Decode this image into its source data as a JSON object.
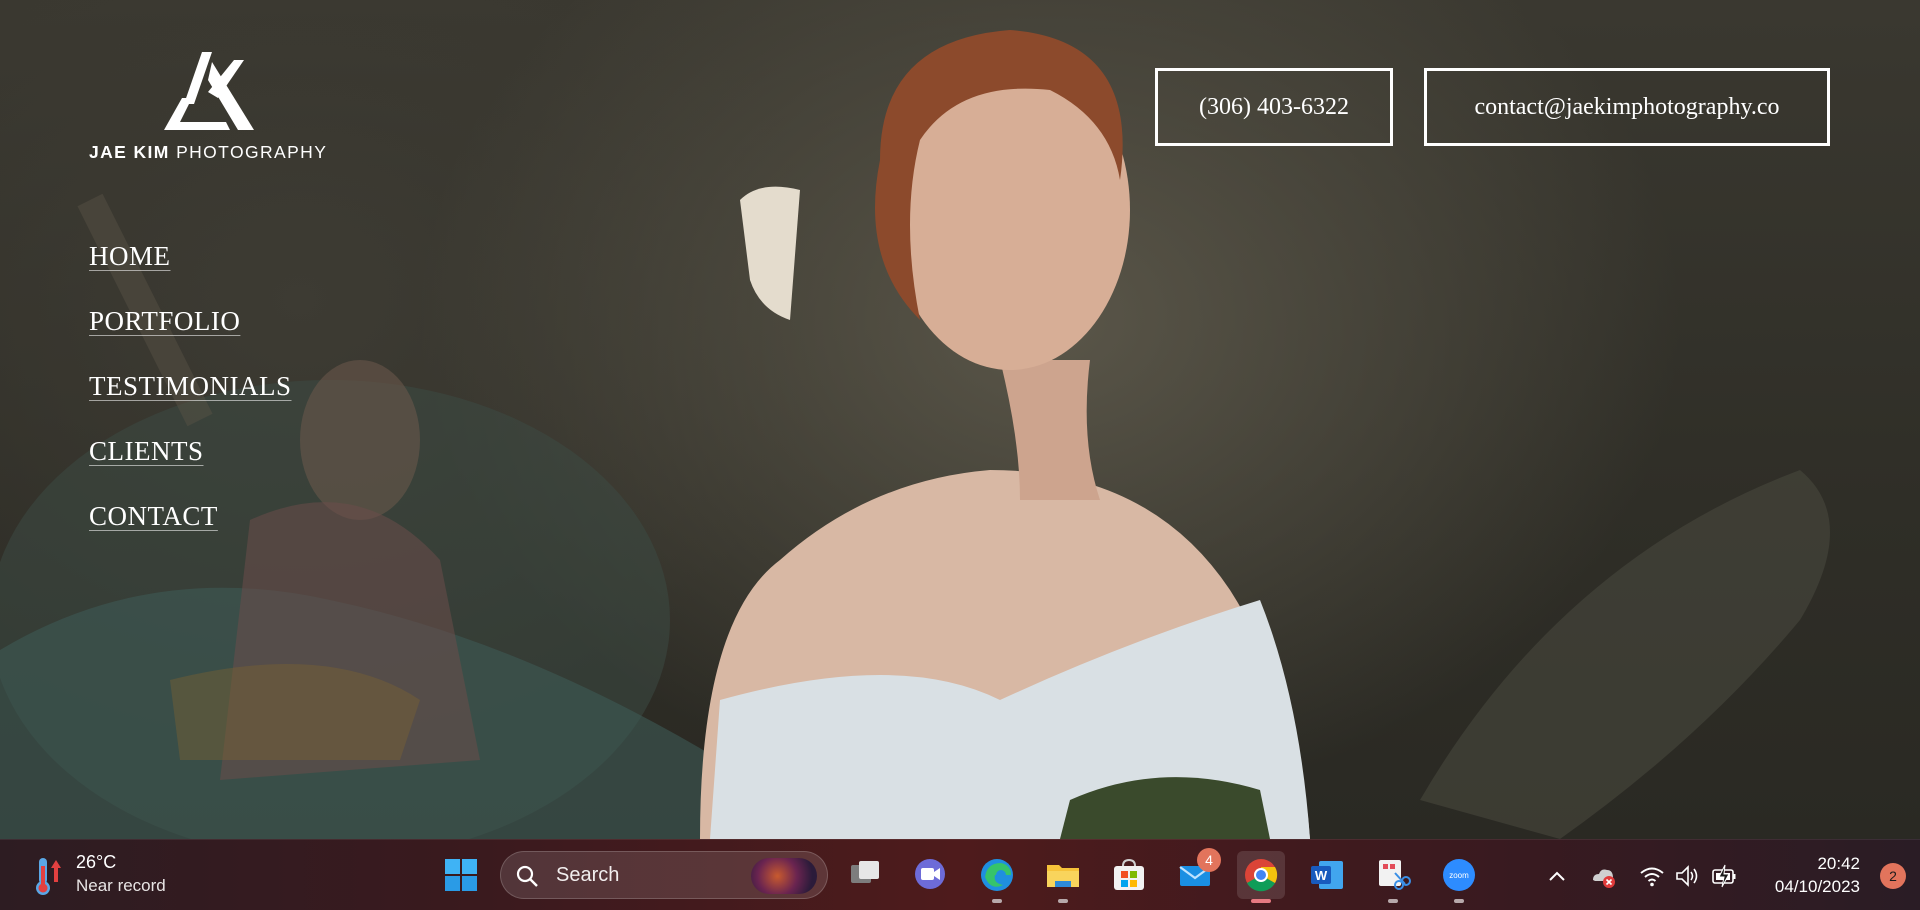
{
  "site": {
    "logo": {
      "brand_bold": "JAE KIM",
      "brand_rest": "PHOTOGRAPHY"
    },
    "nav": [
      {
        "label": "HOME"
      },
      {
        "label": "PORTFOLIO"
      },
      {
        "label": "TESTIMONIALS"
      },
      {
        "label": "CLIENTS"
      },
      {
        "label": "CONTACT"
      }
    ],
    "contact": {
      "phone": "(306) 403-6322",
      "email": "contact@jaekimphotography.co"
    }
  },
  "taskbar": {
    "weather": {
      "temp": "26°C",
      "desc": "Near record",
      "icon": "thermometer-icon"
    },
    "search": {
      "placeholder": "Search"
    },
    "apps": [
      {
        "name": "start",
        "icon": "windows-start-icon"
      },
      {
        "name": "task-view",
        "icon": "task-view-icon"
      },
      {
        "name": "chat",
        "icon": "teams-chat-icon"
      },
      {
        "name": "edge",
        "icon": "edge-icon",
        "running": true
      },
      {
        "name": "file-explorer",
        "icon": "folder-icon",
        "running": true
      },
      {
        "name": "store",
        "icon": "store-icon"
      },
      {
        "name": "mail",
        "icon": "mail-icon",
        "badge": "4"
      },
      {
        "name": "chrome",
        "icon": "chrome-icon",
        "running": true,
        "active": true
      },
      {
        "name": "word",
        "icon": "word-icon"
      },
      {
        "name": "snipping-tool",
        "icon": "snipping-tool-icon",
        "running": true
      },
      {
        "name": "zoom",
        "icon": "zoom-icon",
        "running": true,
        "label": "zoom"
      }
    ],
    "tray": {
      "time": "20:42",
      "date": "04/10/2023",
      "notifications": "2"
    }
  },
  "colors": {
    "badge": "#e2745c",
    "active_indicator": "#e77a82",
    "taskbar_bg": "#4e1b1c"
  }
}
